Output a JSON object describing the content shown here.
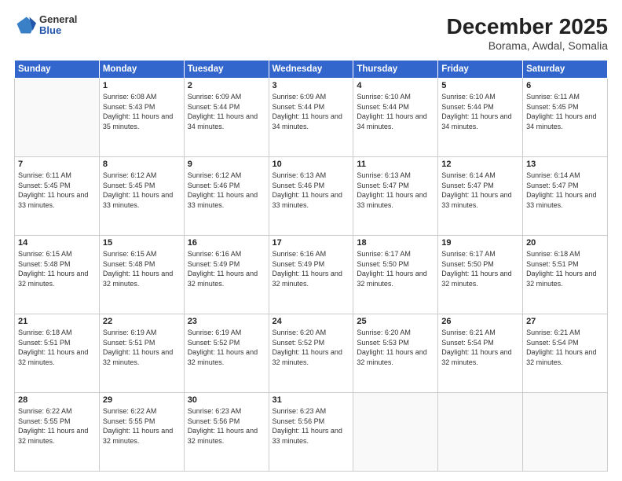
{
  "header": {
    "logo": {
      "general": "General",
      "blue": "Blue"
    },
    "title": "December 2025",
    "location": "Borama, Awdal, Somalia"
  },
  "weekdays": [
    "Sunday",
    "Monday",
    "Tuesday",
    "Wednesday",
    "Thursday",
    "Friday",
    "Saturday"
  ],
  "weeks": [
    [
      {
        "day": "",
        "empty": true
      },
      {
        "day": "1",
        "sunrise": "6:08 AM",
        "sunset": "5:43 PM",
        "daylight": "11 hours and 35 minutes."
      },
      {
        "day": "2",
        "sunrise": "6:09 AM",
        "sunset": "5:44 PM",
        "daylight": "11 hours and 34 minutes."
      },
      {
        "day": "3",
        "sunrise": "6:09 AM",
        "sunset": "5:44 PM",
        "daylight": "11 hours and 34 minutes."
      },
      {
        "day": "4",
        "sunrise": "6:10 AM",
        "sunset": "5:44 PM",
        "daylight": "11 hours and 34 minutes."
      },
      {
        "day": "5",
        "sunrise": "6:10 AM",
        "sunset": "5:44 PM",
        "daylight": "11 hours and 34 minutes."
      },
      {
        "day": "6",
        "sunrise": "6:11 AM",
        "sunset": "5:45 PM",
        "daylight": "11 hours and 34 minutes."
      }
    ],
    [
      {
        "day": "7",
        "sunrise": "6:11 AM",
        "sunset": "5:45 PM",
        "daylight": "11 hours and 33 minutes."
      },
      {
        "day": "8",
        "sunrise": "6:12 AM",
        "sunset": "5:45 PM",
        "daylight": "11 hours and 33 minutes."
      },
      {
        "day": "9",
        "sunrise": "6:12 AM",
        "sunset": "5:46 PM",
        "daylight": "11 hours and 33 minutes."
      },
      {
        "day": "10",
        "sunrise": "6:13 AM",
        "sunset": "5:46 PM",
        "daylight": "11 hours and 33 minutes."
      },
      {
        "day": "11",
        "sunrise": "6:13 AM",
        "sunset": "5:47 PM",
        "daylight": "11 hours and 33 minutes."
      },
      {
        "day": "12",
        "sunrise": "6:14 AM",
        "sunset": "5:47 PM",
        "daylight": "11 hours and 33 minutes."
      },
      {
        "day": "13",
        "sunrise": "6:14 AM",
        "sunset": "5:47 PM",
        "daylight": "11 hours and 33 minutes."
      }
    ],
    [
      {
        "day": "14",
        "sunrise": "6:15 AM",
        "sunset": "5:48 PM",
        "daylight": "11 hours and 32 minutes."
      },
      {
        "day": "15",
        "sunrise": "6:15 AM",
        "sunset": "5:48 PM",
        "daylight": "11 hours and 32 minutes."
      },
      {
        "day": "16",
        "sunrise": "6:16 AM",
        "sunset": "5:49 PM",
        "daylight": "11 hours and 32 minutes."
      },
      {
        "day": "17",
        "sunrise": "6:16 AM",
        "sunset": "5:49 PM",
        "daylight": "11 hours and 32 minutes."
      },
      {
        "day": "18",
        "sunrise": "6:17 AM",
        "sunset": "5:50 PM",
        "daylight": "11 hours and 32 minutes."
      },
      {
        "day": "19",
        "sunrise": "6:17 AM",
        "sunset": "5:50 PM",
        "daylight": "11 hours and 32 minutes."
      },
      {
        "day": "20",
        "sunrise": "6:18 AM",
        "sunset": "5:51 PM",
        "daylight": "11 hours and 32 minutes."
      }
    ],
    [
      {
        "day": "21",
        "sunrise": "6:18 AM",
        "sunset": "5:51 PM",
        "daylight": "11 hours and 32 minutes."
      },
      {
        "day": "22",
        "sunrise": "6:19 AM",
        "sunset": "5:51 PM",
        "daylight": "11 hours and 32 minutes."
      },
      {
        "day": "23",
        "sunrise": "6:19 AM",
        "sunset": "5:52 PM",
        "daylight": "11 hours and 32 minutes."
      },
      {
        "day": "24",
        "sunrise": "6:20 AM",
        "sunset": "5:52 PM",
        "daylight": "11 hours and 32 minutes."
      },
      {
        "day": "25",
        "sunrise": "6:20 AM",
        "sunset": "5:53 PM",
        "daylight": "11 hours and 32 minutes."
      },
      {
        "day": "26",
        "sunrise": "6:21 AM",
        "sunset": "5:54 PM",
        "daylight": "11 hours and 32 minutes."
      },
      {
        "day": "27",
        "sunrise": "6:21 AM",
        "sunset": "5:54 PM",
        "daylight": "11 hours and 32 minutes."
      }
    ],
    [
      {
        "day": "28",
        "sunrise": "6:22 AM",
        "sunset": "5:55 PM",
        "daylight": "11 hours and 32 minutes."
      },
      {
        "day": "29",
        "sunrise": "6:22 AM",
        "sunset": "5:55 PM",
        "daylight": "11 hours and 32 minutes."
      },
      {
        "day": "30",
        "sunrise": "6:23 AM",
        "sunset": "5:56 PM",
        "daylight": "11 hours and 32 minutes."
      },
      {
        "day": "31",
        "sunrise": "6:23 AM",
        "sunset": "5:56 PM",
        "daylight": "11 hours and 33 minutes."
      },
      {
        "day": "",
        "empty": true
      },
      {
        "day": "",
        "empty": true
      },
      {
        "day": "",
        "empty": true
      }
    ]
  ],
  "labels": {
    "sunrise": "Sunrise:",
    "sunset": "Sunset:",
    "daylight": "Daylight:"
  }
}
